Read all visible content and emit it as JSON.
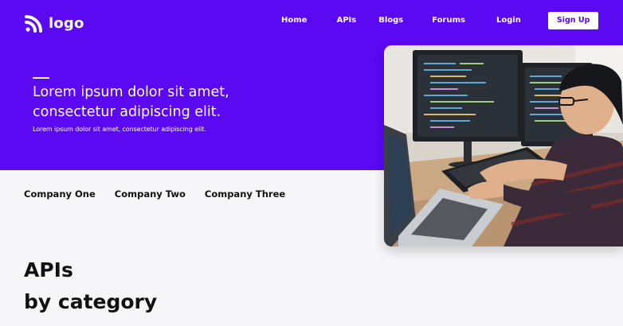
{
  "brand": {
    "logo_text": "logo",
    "icon": "rss-icon",
    "color": "#5b08f3"
  },
  "nav": {
    "links": [
      "Home",
      "APIs",
      "Blogs",
      "Forums",
      "Login"
    ],
    "signup_label": "Sign Up",
    "search_icon": "search-icon"
  },
  "hero": {
    "headline_line1": "Lorem ipsum dolor sit amet,",
    "headline_line2": "consectetur adipiscing elit.",
    "subtext": "Lorem ipsum dolor sit amet, consectetur adipiscing elit.",
    "image": "developer-at-computer-photo"
  },
  "companies": [
    "Company One",
    "Company Two",
    "Company Three"
  ],
  "section": {
    "title_line1": "APIs",
    "title_line2": "by category"
  }
}
